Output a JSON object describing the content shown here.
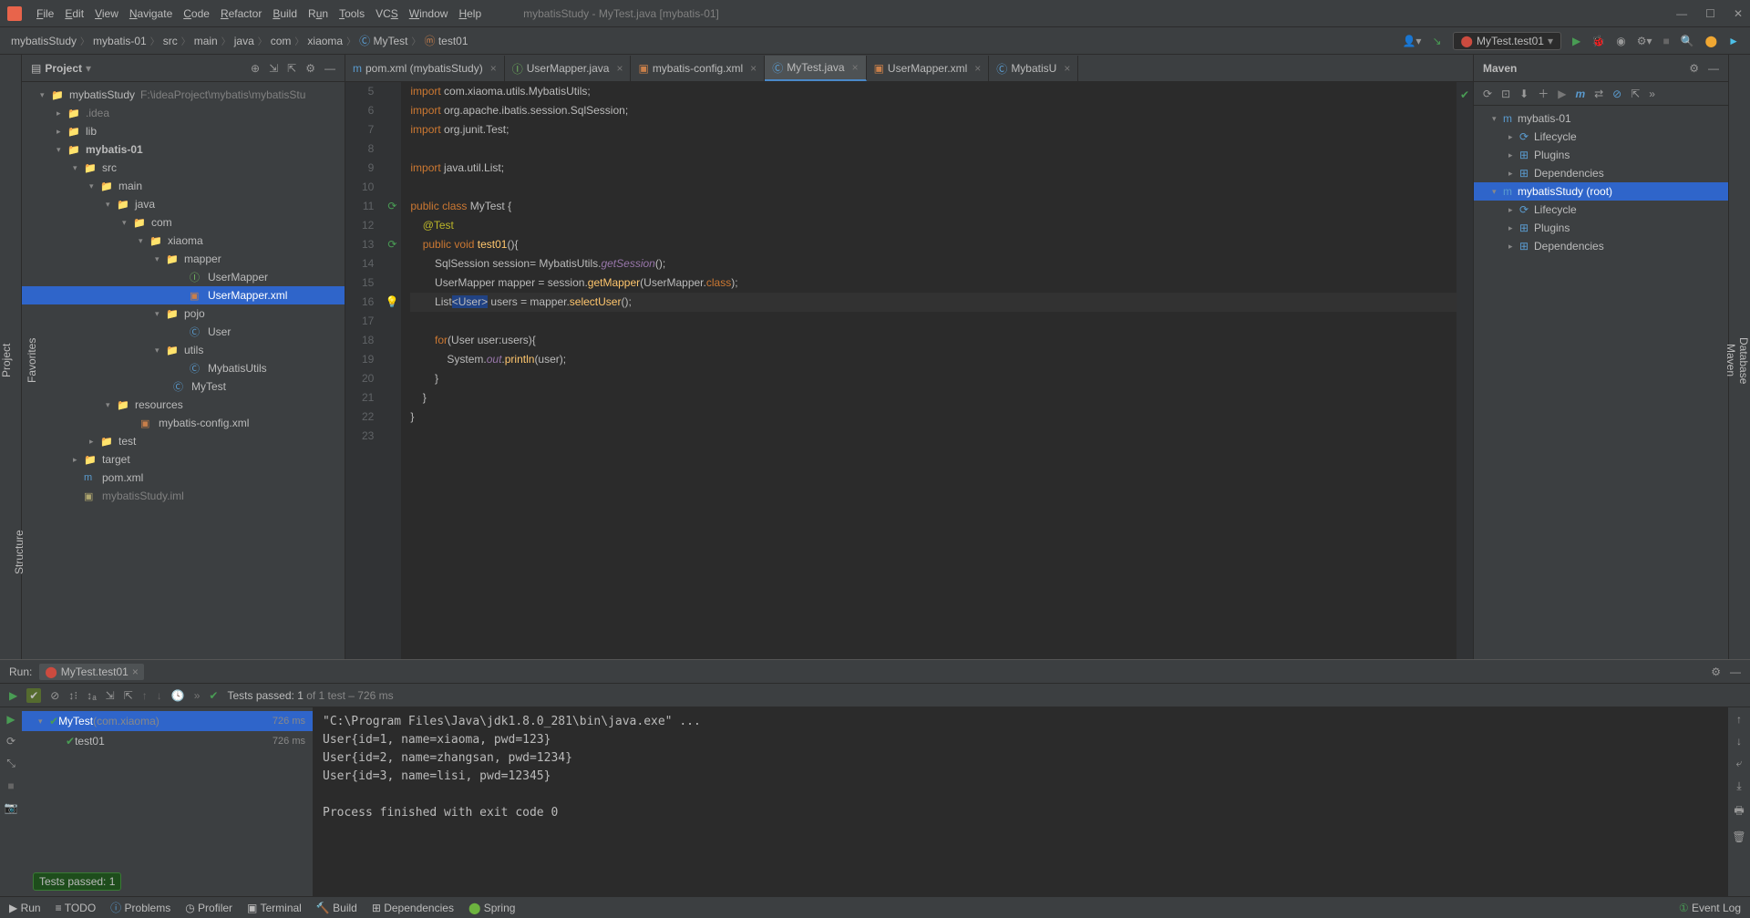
{
  "title": "mybatisStudy - MyTest.java [mybatis-01]",
  "menu": {
    "file": "File",
    "edit": "Edit",
    "view": "View",
    "navigate": "Navigate",
    "code": "Code",
    "refactor": "Refactor",
    "build": "Build",
    "run": "Run",
    "tools": "Tools",
    "vcs": "VCS",
    "window": "Window",
    "help": "Help"
  },
  "breadcrumbs": [
    "mybatisStudy",
    "mybatis-01",
    "src",
    "main",
    "java",
    "com",
    "xiaoma",
    "MyTest",
    "test01"
  ],
  "run_config": "MyTest.test01",
  "project": {
    "title": "Project",
    "root": "mybatisStudy",
    "root_path": "F:\\ideaProject\\mybatis\\mybatisStu",
    "items": [
      {
        "ind": 20,
        "arrow": "▾",
        "icon": "📁",
        "label": "mybatisStudy",
        "extra": "F:\\ideaProject\\mybatis\\mybatisStu"
      },
      {
        "ind": 38,
        "arrow": "▸",
        "icon": "📁",
        "label": ".idea",
        "faded": true
      },
      {
        "ind": 38,
        "arrow": "▸",
        "icon": "📁",
        "label": "lib"
      },
      {
        "ind": 38,
        "arrow": "▾",
        "icon": "📁",
        "label": "mybatis-01",
        "bold": true
      },
      {
        "ind": 56,
        "arrow": "▾",
        "icon": "📁",
        "label": "src"
      },
      {
        "ind": 74,
        "arrow": "▾",
        "icon": "📁",
        "label": "main"
      },
      {
        "ind": 92,
        "arrow": "▾",
        "icon": "📁",
        "label": "java"
      },
      {
        "ind": 110,
        "arrow": "▾",
        "icon": "📁",
        "label": "com"
      },
      {
        "ind": 128,
        "arrow": "▾",
        "icon": "📁",
        "label": "xiaoma"
      },
      {
        "ind": 146,
        "arrow": "▾",
        "icon": "📁",
        "label": "mapper"
      },
      {
        "ind": 172,
        "arrow": "",
        "icon": "Ⓘ",
        "label": "UserMapper",
        "iconColor": "#6fb35f"
      },
      {
        "ind": 172,
        "arrow": "",
        "icon": "▣",
        "label": "UserMapper.xml",
        "sel": true,
        "iconColor": "#c97f4a"
      },
      {
        "ind": 146,
        "arrow": "▾",
        "icon": "📁",
        "label": "pojo"
      },
      {
        "ind": 172,
        "arrow": "",
        "icon": "Ⓒ",
        "label": "User",
        "iconColor": "#5a9bcf"
      },
      {
        "ind": 146,
        "arrow": "▾",
        "icon": "📁",
        "label": "utils"
      },
      {
        "ind": 172,
        "arrow": "",
        "icon": "Ⓒ",
        "label": "MybatisUtils",
        "iconColor": "#5a9bcf"
      },
      {
        "ind": 154,
        "arrow": "",
        "icon": "Ⓒ",
        "label": "MyTest",
        "iconColor": "#5a9bcf"
      },
      {
        "ind": 92,
        "arrow": "▾",
        "icon": "📁",
        "label": "resources"
      },
      {
        "ind": 118,
        "arrow": "",
        "icon": "▣",
        "label": "mybatis-config.xml",
        "iconColor": "#c97f4a"
      },
      {
        "ind": 74,
        "arrow": "▸",
        "icon": "📁",
        "label": "test"
      },
      {
        "ind": 56,
        "arrow": "▸",
        "icon": "📁",
        "label": "target",
        "iconColor": "#cd7832"
      },
      {
        "ind": 56,
        "arrow": "",
        "icon": "m",
        "label": "pom.xml",
        "iconColor": "#5a9bcf"
      },
      {
        "ind": 56,
        "arrow": "",
        "icon": "▣",
        "label": "mybatisStudy.iml",
        "faded": true
      }
    ]
  },
  "tabs": [
    {
      "icon": "m",
      "label": "pom.xml (mybatisStudy)",
      "iconColor": "#5a9bcf"
    },
    {
      "icon": "Ⓘ",
      "label": "UserMapper.java",
      "iconColor": "#6fb35f"
    },
    {
      "icon": "▣",
      "label": "mybatis-config.xml",
      "iconColor": "#c97f4a"
    },
    {
      "icon": "Ⓒ",
      "label": "MyTest.java",
      "active": true,
      "iconColor": "#5a9bcf"
    },
    {
      "icon": "▣",
      "label": "UserMapper.xml",
      "iconColor": "#c97f4a"
    },
    {
      "icon": "Ⓒ",
      "label": "MybatisU",
      "iconColor": "#5a9bcf"
    }
  ],
  "code": {
    "start": 5,
    "lines": [
      "import com.xiaoma.utils.MybatisUtils;",
      "import org.apache.ibatis.session.SqlSession;",
      "import org.junit.Test;",
      "",
      "import java.util.List;",
      "",
      "public class MyTest {",
      "    @Test",
      "    public void test01(){",
      "        SqlSession session= MybatisUtils.getSession();",
      "        UserMapper mapper = session.getMapper(UserMapper.class);",
      "        List<User> users = mapper.selectUser();",
      "",
      "        for(User user:users){",
      "            System.out.println(user);",
      "        }",
      "    }",
      "}",
      ""
    ]
  },
  "maven": {
    "title": "Maven",
    "items": [
      {
        "ind": 10,
        "arrow": "▾",
        "label": "mybatis-01",
        "icon": "m"
      },
      {
        "ind": 28,
        "arrow": "▸",
        "label": "Lifecycle",
        "icon": "⟳"
      },
      {
        "ind": 28,
        "arrow": "▸",
        "label": "Plugins",
        "icon": "⊞"
      },
      {
        "ind": 28,
        "arrow": "▸",
        "label": "Dependencies",
        "icon": "⊞"
      },
      {
        "ind": 10,
        "arrow": "▾",
        "label": "mybatisStudy (root)",
        "icon": "m",
        "sel": true
      },
      {
        "ind": 28,
        "arrow": "▸",
        "label": "Lifecycle",
        "icon": "⟳"
      },
      {
        "ind": 28,
        "arrow": "▸",
        "label": "Plugins",
        "icon": "⊞"
      },
      {
        "ind": 28,
        "arrow": "▸",
        "label": "Dependencies",
        "icon": "⊞"
      }
    ]
  },
  "run": {
    "label": "Run:",
    "tab": "MyTest.test01",
    "status": "Tests passed: 1",
    "status_suffix": " of 1 test – 726 ms",
    "tree": [
      {
        "ind": 0,
        "arrow": "▾",
        "pass": true,
        "label": "MyTest",
        "pkg": "(com.xiaoma)",
        "time": "726 ms",
        "sel": true
      },
      {
        "ind": 18,
        "arrow": "",
        "pass": true,
        "label": "test01",
        "time": "726 ms"
      }
    ],
    "console": "\"C:\\Program Files\\Java\\jdk1.8.0_281\\bin\\java.exe\" ...\nUser{id=1, name=xiaoma, pwd=123}\nUser{id=2, name=zhangsan, pwd=1234}\nUser{id=3, name=lisi, pwd=12345}\n\nProcess finished with exit code 0"
  },
  "tooltip": "Tests passed: 1",
  "status": {
    "run": "Run",
    "todo": "TODO",
    "problems": "Problems",
    "profiler": "Profiler",
    "terminal": "Terminal",
    "build": "Build",
    "deps": "Dependencies",
    "spring": "Spring",
    "eventlog": "Event Log"
  },
  "sidetabs": {
    "project": "Project",
    "structure": "Structure",
    "favorites": "Favorites",
    "maven": "Maven",
    "database": "Database"
  }
}
